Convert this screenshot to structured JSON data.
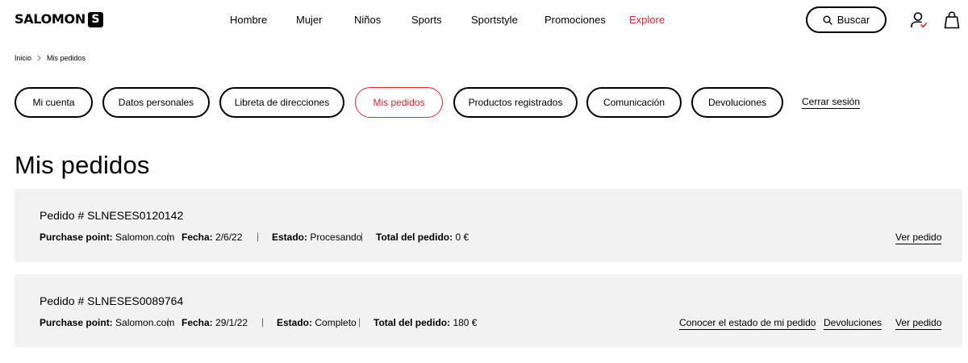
{
  "header": {
    "logo_text": "SALOMON",
    "logo_mark": "S",
    "nav": [
      "Hombre",
      "Mujer",
      "Niños",
      "Sports",
      "Sportstyle",
      "Promociones",
      "Explore"
    ],
    "search_label": "Buscar",
    "accent_color": "#e6262c"
  },
  "breadcrumb": [
    "Inicio",
    "Mis pedidos"
  ],
  "account_nav": {
    "items": [
      "Mi cuenta",
      "Datos personales",
      "Libreta de direcciones",
      "Mis pedidos",
      "Productos registrados",
      "Comunicación",
      "Devoluciones"
    ],
    "active": "Mis pedidos",
    "logout": "Cerrar sesión"
  },
  "page_title": "Mis pedidos",
  "labels": {
    "purchase_point": "Purchase point:",
    "date": "Fecha:",
    "status": "Estado:",
    "total": "Total del pedido:"
  },
  "orders": [
    {
      "number": "Pedido # SLNESES0120142",
      "purchase_point": "Salomon.com",
      "date": "2/6/22",
      "status": "Procesando",
      "total": "0 €",
      "links": [
        "Ver pedido"
      ]
    },
    {
      "number": "Pedido # SLNESES0089764",
      "purchase_point": "Salomon.com",
      "date": "29/1/22",
      "status": "Completo",
      "total": "180 €",
      "links": [
        "Conocer el estado de mi pedido",
        "Devoluciones",
        "Ver pedido"
      ]
    }
  ]
}
